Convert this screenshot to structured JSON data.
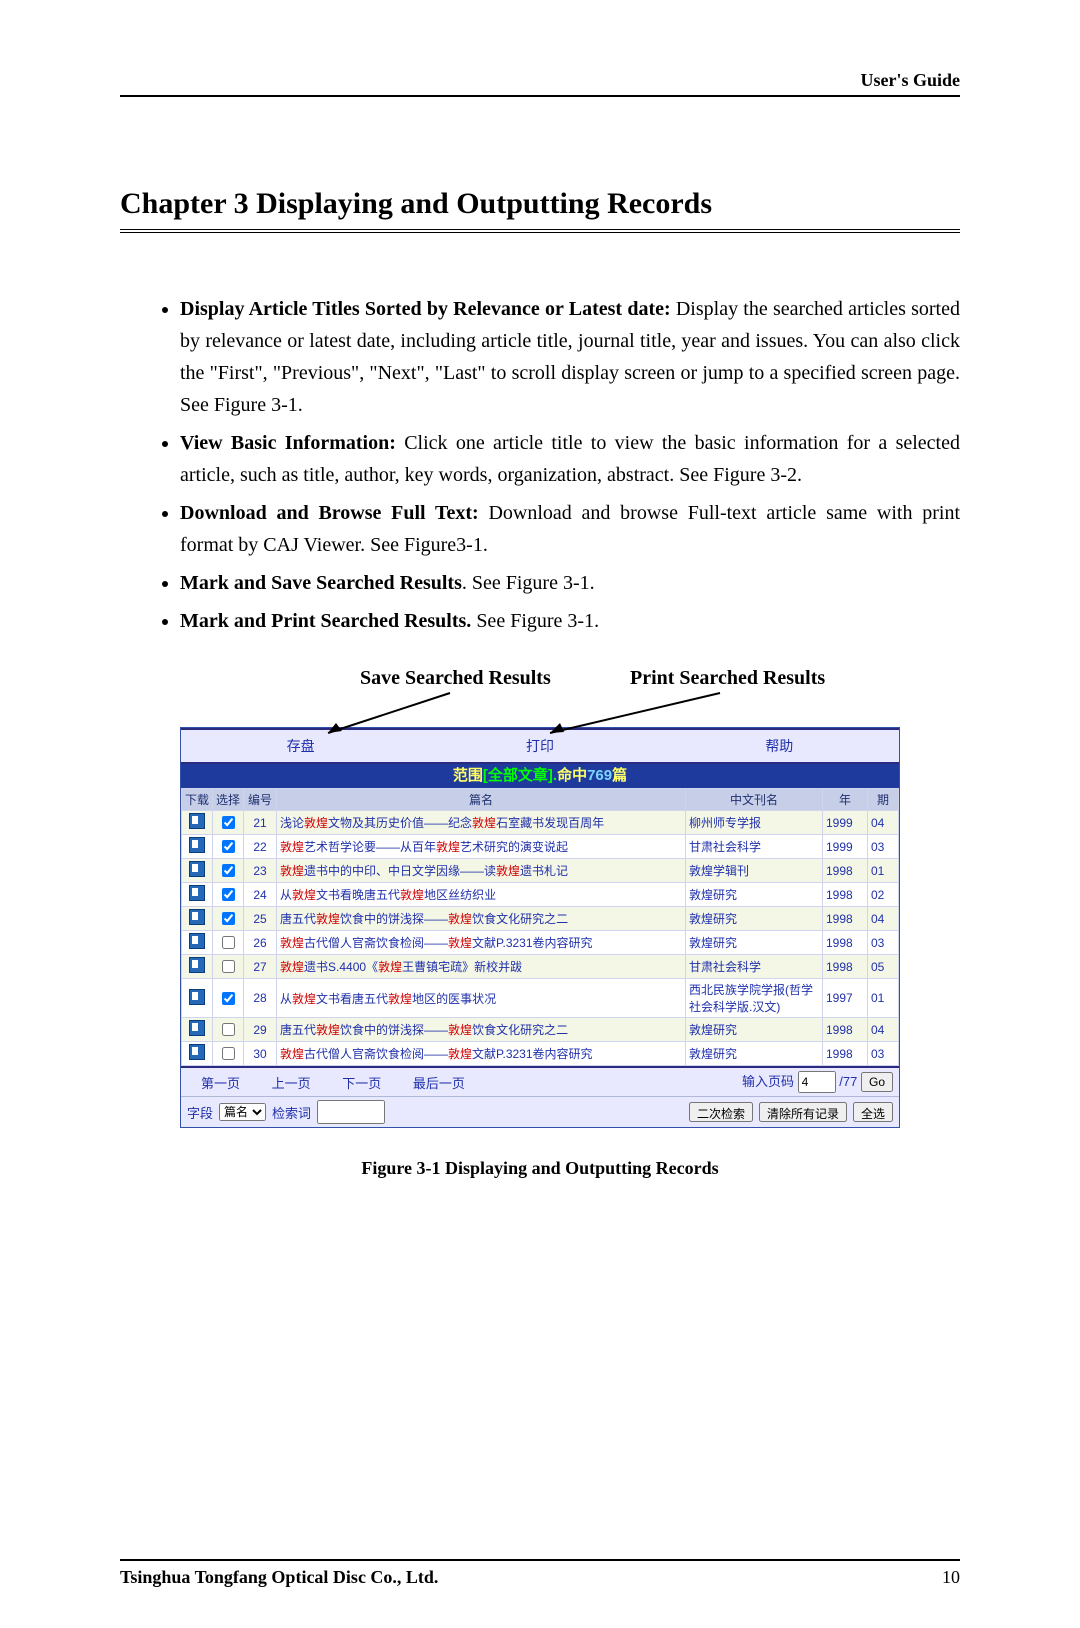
{
  "header": {
    "right": "User's Guide"
  },
  "chapter": {
    "title": "Chapter 3   Displaying and Outputting Records"
  },
  "bullets": [
    {
      "strong": "Display Article Titles Sorted by Relevance or Latest date:",
      "rest": " Display the searched articles sorted by relevance or latest date, including article title, journal title, year and issues. You can also click the \"First\", \"Previous\", \"Next\", \"Last\" to scroll display screen or jump to a specified screen page. See Figure 3-1."
    },
    {
      "strong": "View Basic Information:",
      "rest": " Click one article title to view the basic information for a selected article, such as title, author, key words, organization, abstract. See Figure 3-2."
    },
    {
      "strong": "Download and Browse Full Text:",
      "rest": " Download and browse Full-text article same with print format by CAJ Viewer. See Figure3-1."
    },
    {
      "strong": "Mark and Save Searched Results",
      "rest": ". See Figure 3-1."
    },
    {
      "strong": "Mark and Print Searched Results.",
      "rest": " See Figure 3-1."
    }
  ],
  "annot": {
    "save": "Save Searched Results",
    "print": "Print Searched Results"
  },
  "shot": {
    "ribbon": {
      "save": "存盘",
      "print": "打印",
      "help": "帮助"
    },
    "scope": {
      "prefix": "范围",
      "bracket_open": "[",
      "all": "全部文章",
      "bracket_close": "].",
      "hit_pre": "命中",
      "count": "769",
      "hit_suf": "篇"
    },
    "head": {
      "dl": "下载",
      "sel": "选择",
      "no": "编号",
      "title": "篇名",
      "jrn": "中文刊名",
      "yr": "年",
      "iss": "期"
    },
    "rows": [
      {
        "chk": true,
        "no": "21",
        "pre": "浅论",
        "kw1": "敦煌",
        "mid": "文物及其历史价值——纪念",
        "kw2": "敦煌",
        "suf": "石室藏书发现百周年",
        "jrn": "柳州师专学报",
        "yr": "1999",
        "iss": "04"
      },
      {
        "chk": true,
        "no": "22",
        "pre": "",
        "kw1": "敦煌",
        "mid": "艺术哲学论要——从百年",
        "kw2": "敦煌",
        "suf": "艺术研究的演变说起",
        "jrn": "甘肃社会科学",
        "yr": "1999",
        "iss": "03"
      },
      {
        "chk": true,
        "no": "23",
        "pre": "",
        "kw1": "敦煌",
        "mid": "遗书中的中印、中日文学因缘——读",
        "kw2": "敦煌",
        "suf": "遗书札记",
        "jrn": "敦煌学辑刊",
        "yr": "1998",
        "iss": "01"
      },
      {
        "chk": true,
        "no": "24",
        "pre": "从",
        "kw1": "敦煌",
        "mid": "文书看晚唐五代",
        "kw2": "敦煌",
        "suf": "地区丝纺织业",
        "jrn": "敦煌研究",
        "yr": "1998",
        "iss": "02"
      },
      {
        "chk": true,
        "no": "25",
        "pre": "唐五代",
        "kw1": "敦煌",
        "mid": "饮食中的饼浅探——",
        "kw2": "敦煌",
        "suf": "饮食文化研究之二",
        "jrn": "敦煌研究",
        "yr": "1998",
        "iss": "04"
      },
      {
        "chk": false,
        "no": "26",
        "pre": "",
        "kw1": "敦煌",
        "mid": "古代僧人官斋饮食检阅——",
        "kw2": "敦煌",
        "suf": "文献P.3231卷内容研究",
        "jrn": "敦煌研究",
        "yr": "1998",
        "iss": "03"
      },
      {
        "chk": false,
        "no": "27",
        "pre": "",
        "kw1": "敦煌",
        "mid": "遗书S.4400《",
        "kw2": "敦煌",
        "suf": "王曹镇宅疏》新校并跋",
        "jrn": "甘肃社会科学",
        "yr": "1998",
        "iss": "05"
      },
      {
        "chk": true,
        "no": "28",
        "pre": "从",
        "kw1": "敦煌",
        "mid": "文书看唐五代",
        "kw2": "敦煌",
        "suf": "地区的医事状况",
        "jrn": "西北民族学院学报(哲学社会科学版.汉文)",
        "yr": "1997",
        "iss": "01"
      },
      {
        "chk": false,
        "no": "29",
        "pre": "唐五代",
        "kw1": "敦煌",
        "mid": "饮食中的饼浅探——",
        "kw2": "敦煌",
        "suf": "饮食文化研究之二",
        "jrn": "敦煌研究",
        "yr": "1998",
        "iss": "04"
      },
      {
        "chk": false,
        "no": "30",
        "pre": "",
        "kw1": "敦煌",
        "mid": "古代僧人官斋饮食检阅——",
        "kw2": "敦煌",
        "suf": "文献P.3231卷内容研究",
        "jrn": "敦煌研究",
        "yr": "1998",
        "iss": "03"
      }
    ],
    "pager": {
      "first": "第一页",
      "prev": "上一页",
      "next": "下一页",
      "last": "最后一页",
      "input_lbl": "输入页码",
      "cur": "4",
      "total": "/77",
      "go": "Go"
    },
    "search": {
      "field": "字段",
      "opt": "篇名",
      "term_lbl": "检索词",
      "term": "",
      "btn1": "二次检索",
      "btn2": "清除所有记录",
      "btn3": "全选"
    }
  },
  "caption": "Figure 3-1     Displaying and Outputting Records",
  "footer": {
    "l": "Tsinghua Tongfang Optical Disc Co., Ltd.",
    "r": "10"
  }
}
